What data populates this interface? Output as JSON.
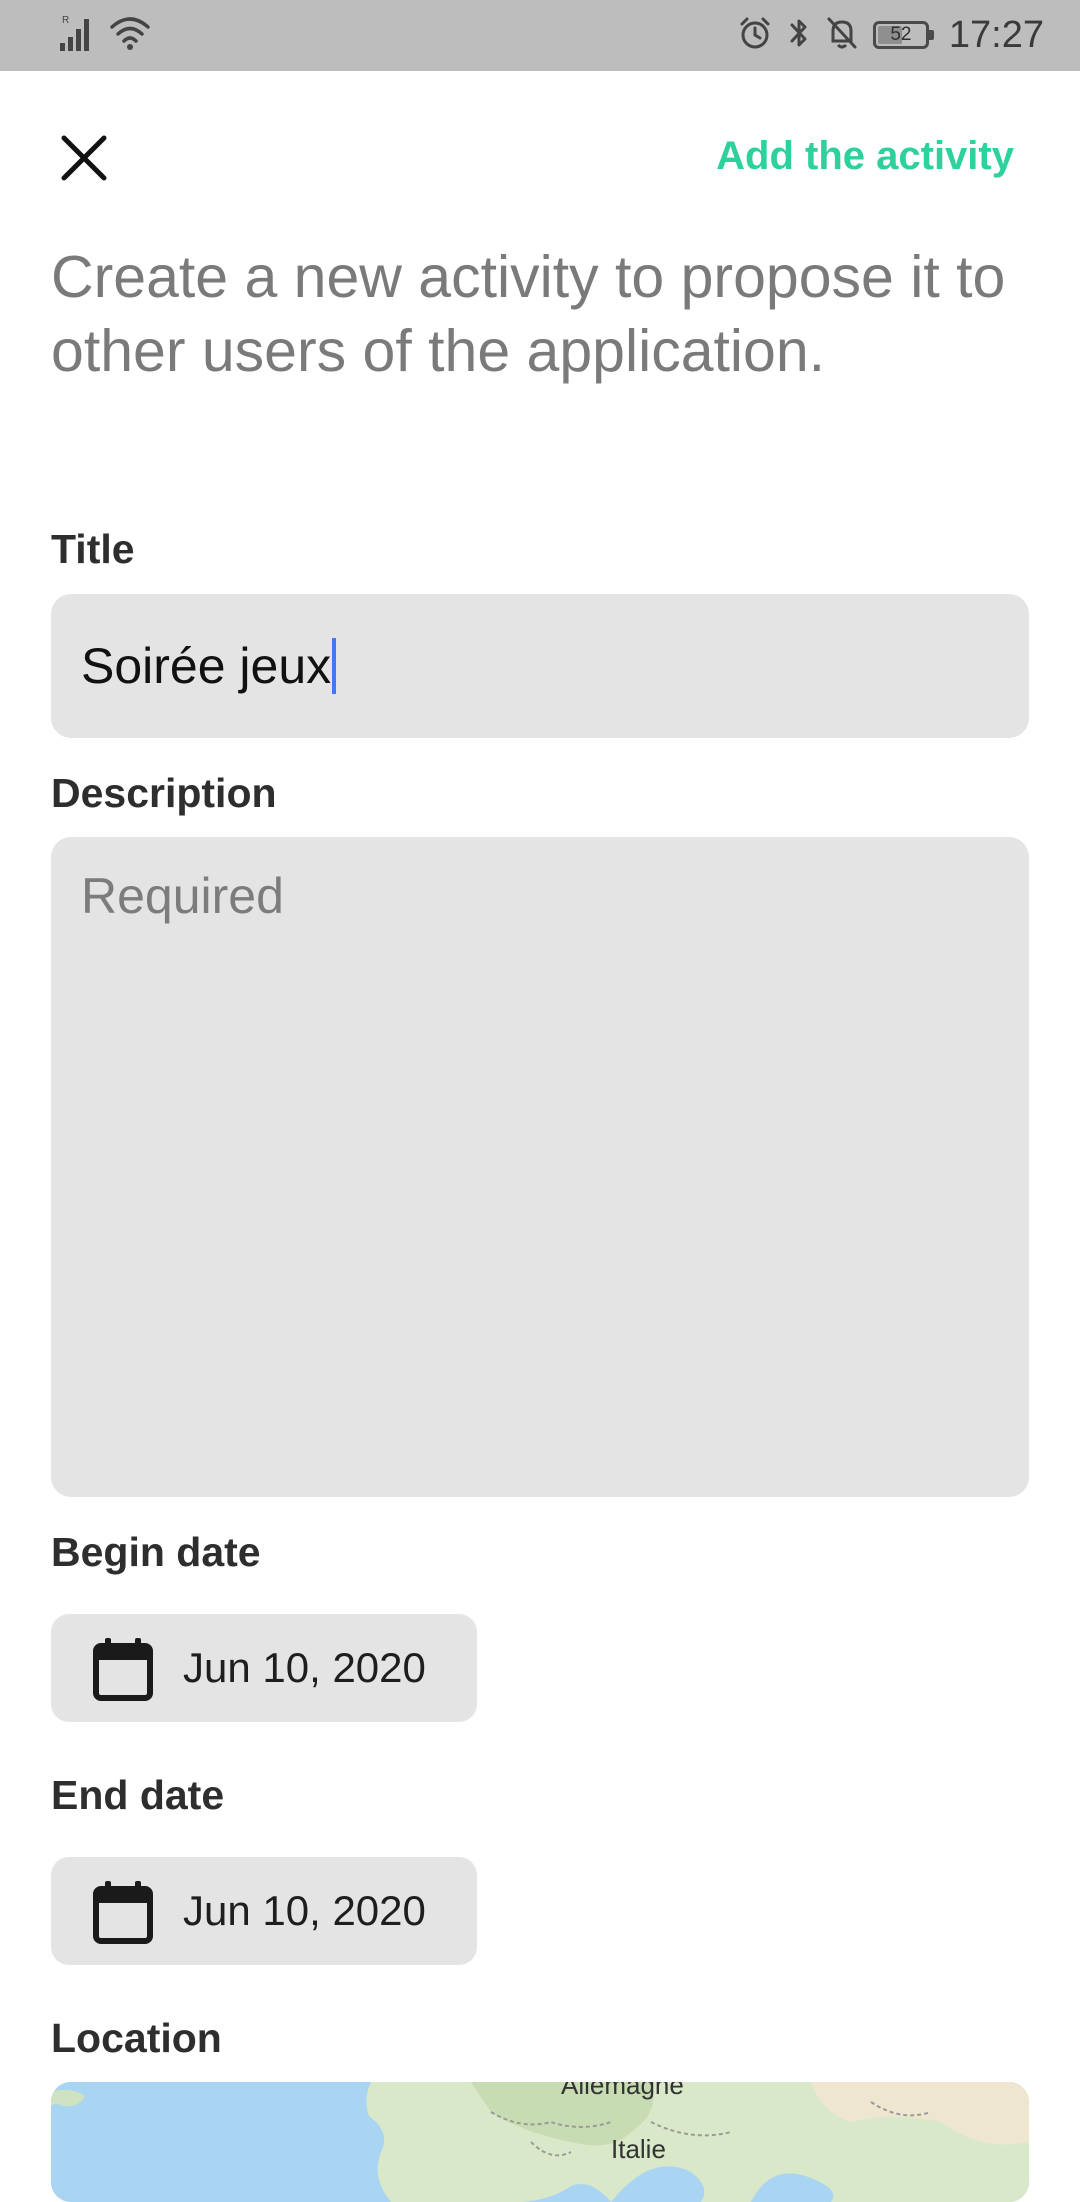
{
  "status_bar": {
    "time": "17:27",
    "battery": 52,
    "network_tag": "R"
  },
  "header": {
    "add_label": "Add the activity"
  },
  "intro_text": "Create a new activity to propose it to other users of the application.",
  "form": {
    "title_label": "Title",
    "title_value": "Soirée jeux",
    "description_label": "Description",
    "description_placeholder": "Required",
    "begin_label": "Begin date",
    "begin_value": "Jun 10, 2020",
    "end_label": "End date",
    "end_value": "Jun 10, 2020",
    "location_label": "Location"
  },
  "map": {
    "label_germany": "Allemagne",
    "label_italy": "Italie"
  },
  "colors": {
    "accent": "#2dd19b",
    "field_bg": "#e4e4e4",
    "status_bar": "#bdbdbd",
    "caret": "#3d7bf0"
  }
}
